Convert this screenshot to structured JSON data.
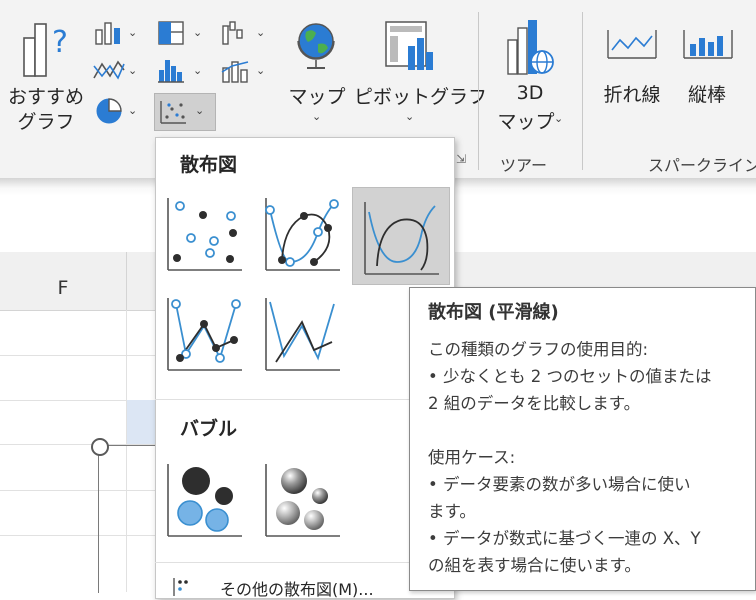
{
  "ribbon": {
    "recommended_label_1": "おすすめ",
    "recommended_label_2": "グラフ",
    "map_label": "マップ",
    "pivot_label": "ピボットグラフ",
    "map3d_label_1": "3D",
    "map3d_label_2": "マップ",
    "tour_group_label": "ツアー",
    "line_label": "折れ線",
    "column_label": "縦棒",
    "sparkline_group_label": "スパークライン"
  },
  "sheet": {
    "column_f": "F"
  },
  "dropdown": {
    "scatter_title": "散布図",
    "bubble_title": "バブル",
    "more_label": "その他の散布図(M)..."
  },
  "tooltip": {
    "title": "散布図 (平滑線)",
    "body": "この種類のグラフの使用目的:\n• 少なくとも 2 つのセットの値または\n2 組のデータを比較します。\n\n使用ケース:\n• データ要素の数が多い場合に使い\nます。\n• データが数式に基づく一連の X、Y\nの組を表す場合に使います。"
  },
  "colors": {
    "accent_blue": "#3a8fd0",
    "dark_marker": "#2e2e2e",
    "hover_gray": "#d2d2d2"
  }
}
